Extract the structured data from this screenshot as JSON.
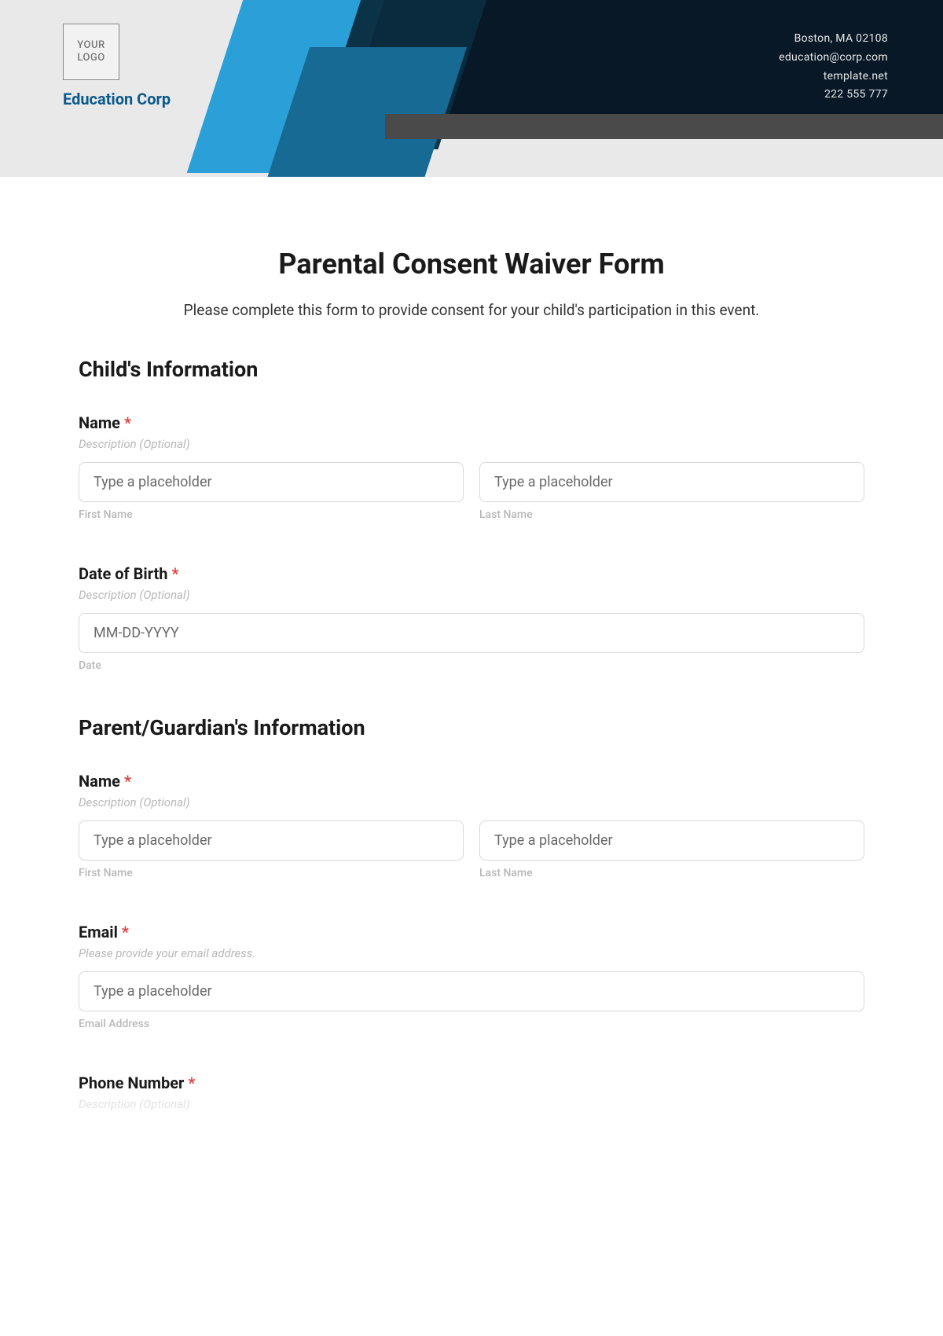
{
  "header": {
    "logo_text": "YOUR LOGO",
    "org_name": "Education Corp",
    "contact": {
      "address": "Boston, MA 02108",
      "email": "education@corp.com",
      "site": "template.net",
      "phone": "222 555 777"
    }
  },
  "form": {
    "title": "Parental Consent Waiver Form",
    "intro": "Please complete this form to provide consent for your child's participation in this event.",
    "child_section": {
      "title": "Child's Information",
      "name": {
        "label": "Name",
        "required": "*",
        "desc": "Description (Optional)",
        "first_placeholder": "Type a placeholder",
        "first_sub": "First Name",
        "last_placeholder": "Type a placeholder",
        "last_sub": "Last Name"
      },
      "dob": {
        "label": "Date of Birth",
        "required": "*",
        "desc": "Description (Optional)",
        "placeholder": "MM-DD-YYYY",
        "sub": "Date"
      }
    },
    "parent_section": {
      "title": "Parent/Guardian's Information",
      "name": {
        "label": "Name",
        "required": "*",
        "desc": "Description (Optional)",
        "first_placeholder": "Type a placeholder",
        "first_sub": "First Name",
        "last_placeholder": "Type a placeholder",
        "last_sub": "Last Name"
      },
      "email": {
        "label": "Email",
        "required": "*",
        "desc": "Please provide your email address.",
        "placeholder": "Type a placeholder",
        "sub": "Email Address"
      },
      "phone": {
        "label": "Phone Number",
        "required": "*",
        "desc": "Description (Optional)"
      }
    }
  }
}
